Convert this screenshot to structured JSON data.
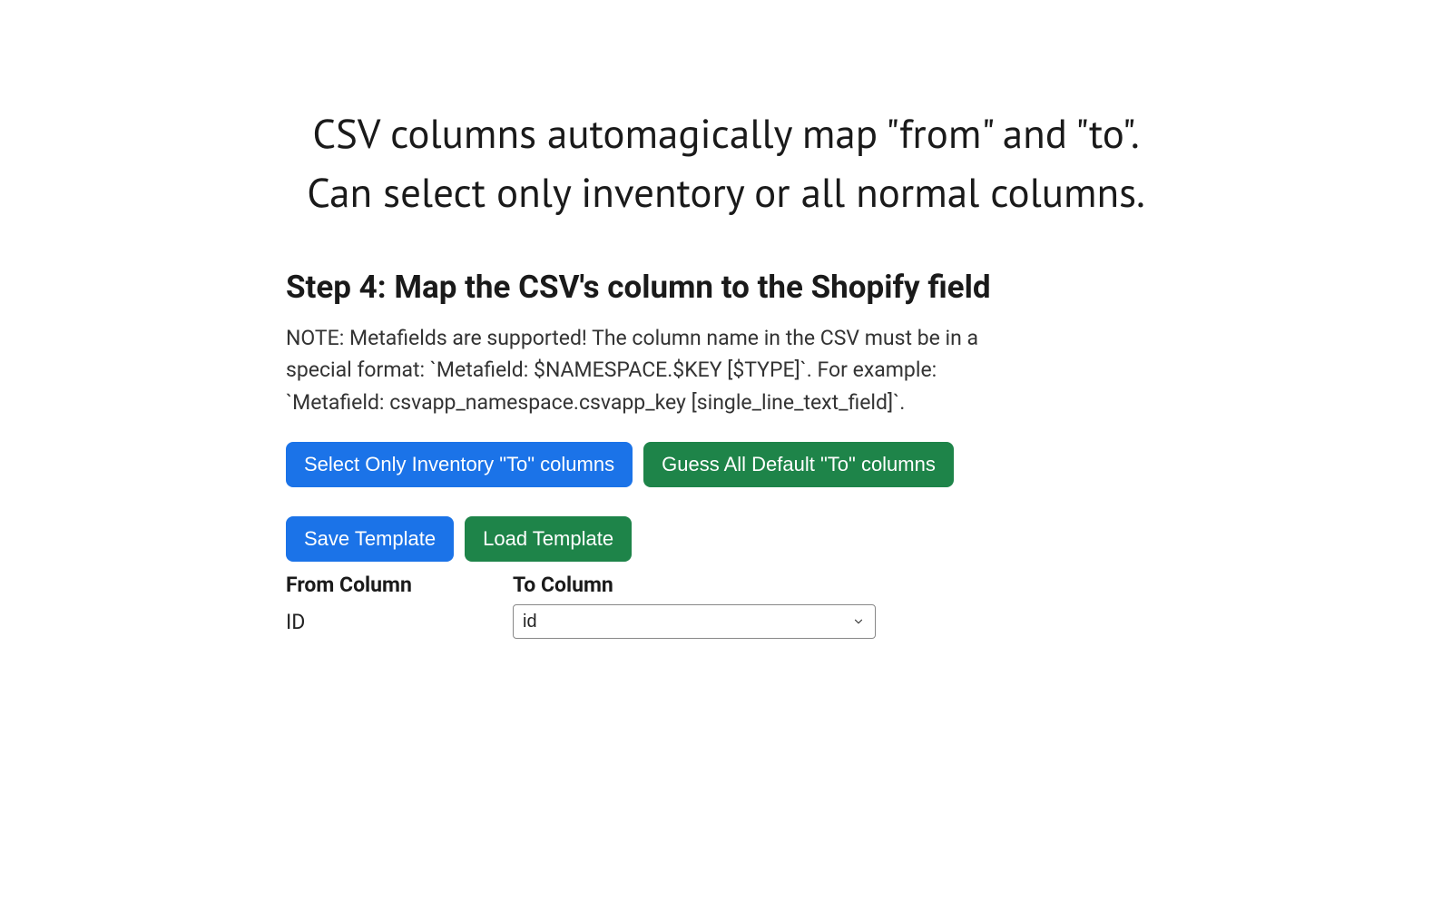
{
  "caption": {
    "line1": "CSV columns automagically map \"from\" and \"to\".",
    "line2": "Can select only inventory or all normal columns."
  },
  "step": {
    "title": "Step 4: Map the CSV's column to the Shopify field",
    "note": "NOTE: Metafields are supported! The column name in the CSV must be in a special format: `Metafield: $NAMESPACE.$KEY [$TYPE]`. For example: `Metafield: csvapp_namespace.csvapp_key [single_line_text_field]`."
  },
  "buttons": {
    "select_inventory": "Select Only Inventory \"To\" columns",
    "guess_all": "Guess All Default \"To\" columns",
    "save_template": "Save Template",
    "load_template": "Load Template"
  },
  "columns": {
    "from_header": "From Column",
    "to_header": "To Column",
    "rows": [
      {
        "from": "ID",
        "to": "id"
      }
    ]
  }
}
